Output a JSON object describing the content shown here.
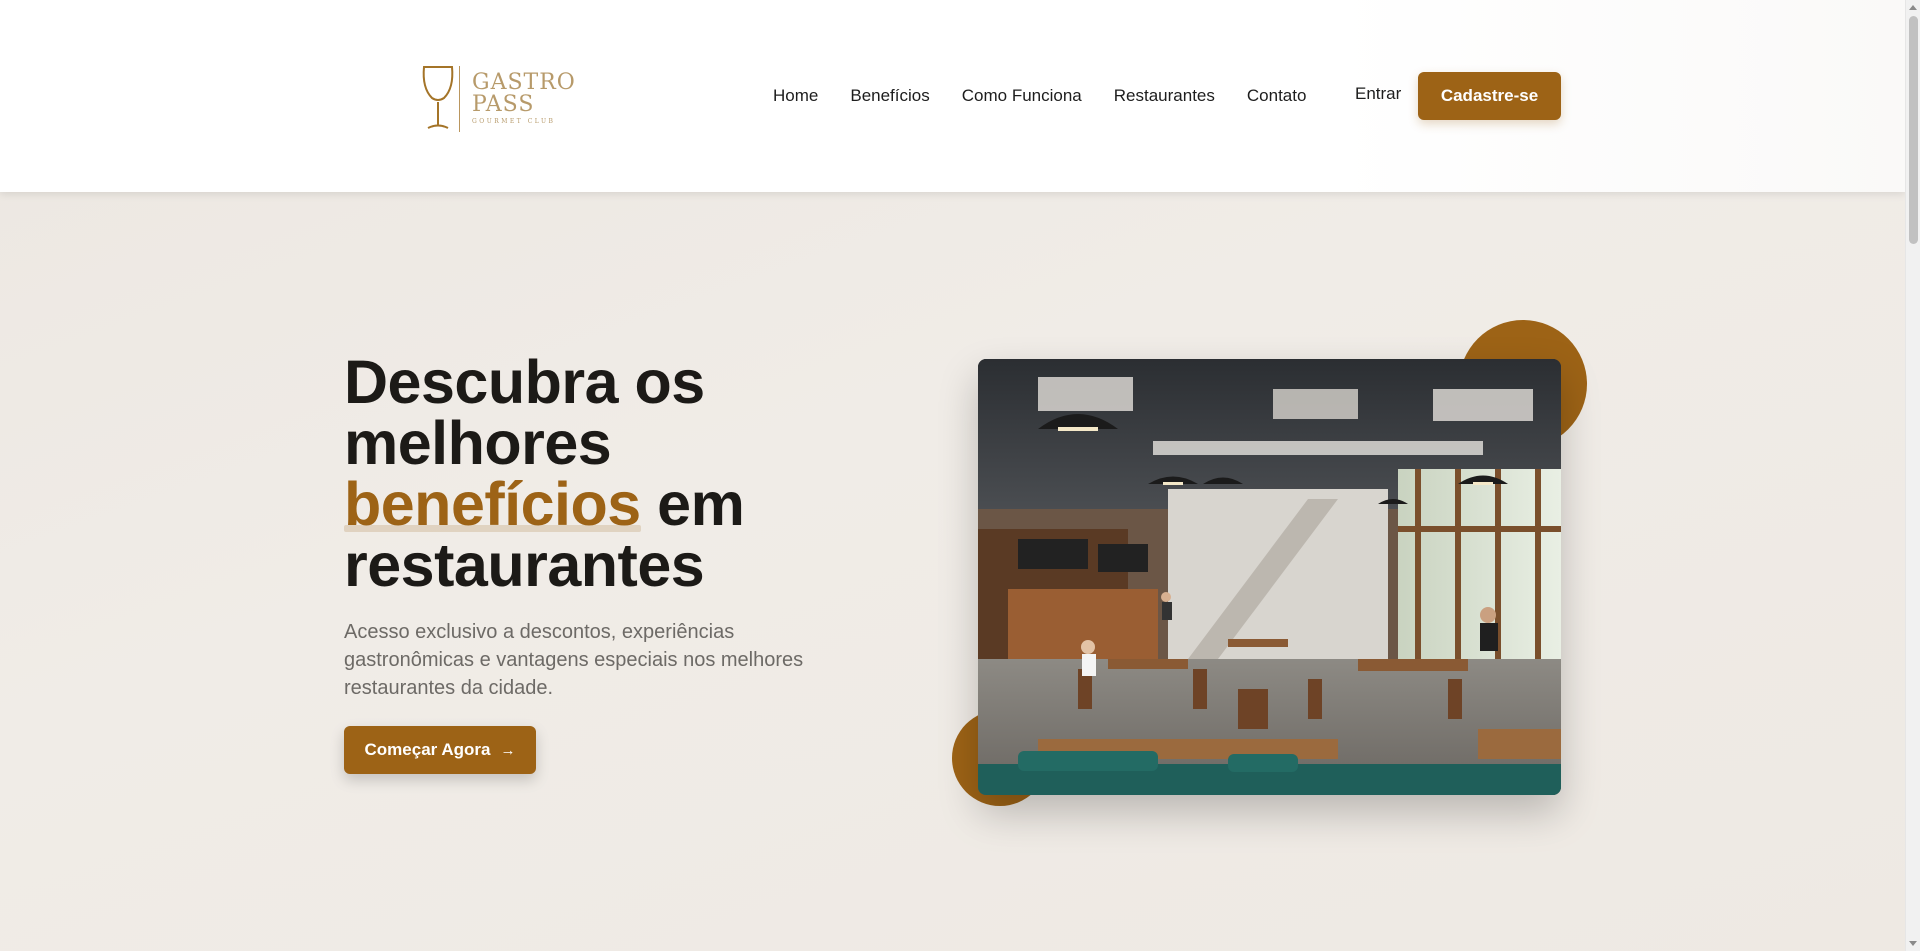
{
  "brand": {
    "line1": "GASTRO",
    "line2": "PASS",
    "tagline": "GOURMET CLUB"
  },
  "nav": {
    "items": [
      "Home",
      "Benefícios",
      "Como Funciona",
      "Restaurantes",
      "Contato"
    ],
    "login_label": "Entrar",
    "signup_label": "Cadastre-se"
  },
  "hero": {
    "title_part1": "Descubra os melhores",
    "title_accent": "benefícios",
    "title_part2": "em restaurantes",
    "description": "Acesso exclusivo a descontos, experiências gastronômicas e vantagens especiais nos melhores restaurantes da cidade.",
    "cta_label": "Começar Agora",
    "image_alt": "restaurant-interior-photo"
  },
  "colors": {
    "accent": "#9d6316",
    "text_dark": "#1c1a17",
    "text_muted": "#6d6a66",
    "background": "#efebe6"
  },
  "icons": {
    "logo": "wine-glass-icon",
    "cta": "arrow-right-icon"
  }
}
